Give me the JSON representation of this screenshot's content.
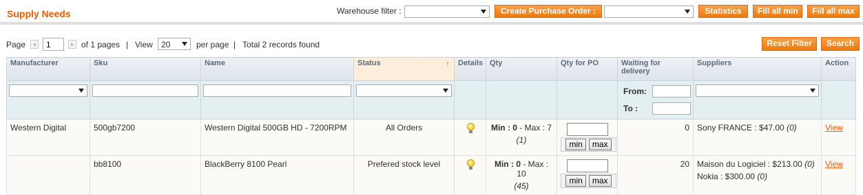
{
  "header": {
    "title": "Supply Needs",
    "warehouse_filter_label": "Warehouse filter :",
    "warehouse_filter_value": "",
    "create_po_label": "Create Purchase Order :",
    "create_po_value": "",
    "statistics_label": "Statistics",
    "fill_min_label": "Fill all min",
    "fill_max_label": "Fill all max"
  },
  "pager": {
    "page_label": "Page",
    "page_value": "1",
    "of_pages": "of 1 pages",
    "separator": "|",
    "view_label": "View",
    "view_value": "20",
    "per_page": "per page",
    "total": "Total 2 records found",
    "reset_filter_label": "Reset Filter",
    "search_label": "Search"
  },
  "columns": {
    "manufacturer": "Manufacturer",
    "sku": "Sku",
    "name": "Name",
    "status": "Status",
    "details": "Details",
    "qty": "Qty",
    "qty_for_po": "Qty for PO",
    "waiting": "Waiting for delivery",
    "suppliers": "Suppliers",
    "action": "Action"
  },
  "filters": {
    "from_label": "From:",
    "to_label": "To :"
  },
  "rows": [
    {
      "manufacturer": "Western Digital",
      "sku": "500gb7200",
      "name": "Western Digital 500GB HD - 7200RPM",
      "status": "All Orders",
      "min_label": "Min :",
      "min": "0",
      "max_label": "- Max :",
      "max": "7",
      "qty_sub": "(1)",
      "min_btn": "min",
      "max_btn": "max",
      "waiting": "0",
      "supplier1": "Sony FRANCE : $47.00",
      "supplier1_count": "(0)",
      "supplier2": "",
      "supplier2_count": "",
      "action": "View"
    },
    {
      "manufacturer": "",
      "sku": "bb8100",
      "name": "BlackBerry 8100 Pearl",
      "status": "Prefered stock level",
      "min_label": "Min :",
      "min": "0",
      "max_label": "- Max :",
      "max": "10",
      "qty_sub": "(45)",
      "min_btn": "min",
      "max_btn": "max",
      "waiting": "20",
      "supplier1": "Maison du Logiciel : $213.00",
      "supplier1_count": "(0)",
      "supplier2": "Nokia : $300.00",
      "supplier2_count": "(0)",
      "action": "View"
    }
  ]
}
